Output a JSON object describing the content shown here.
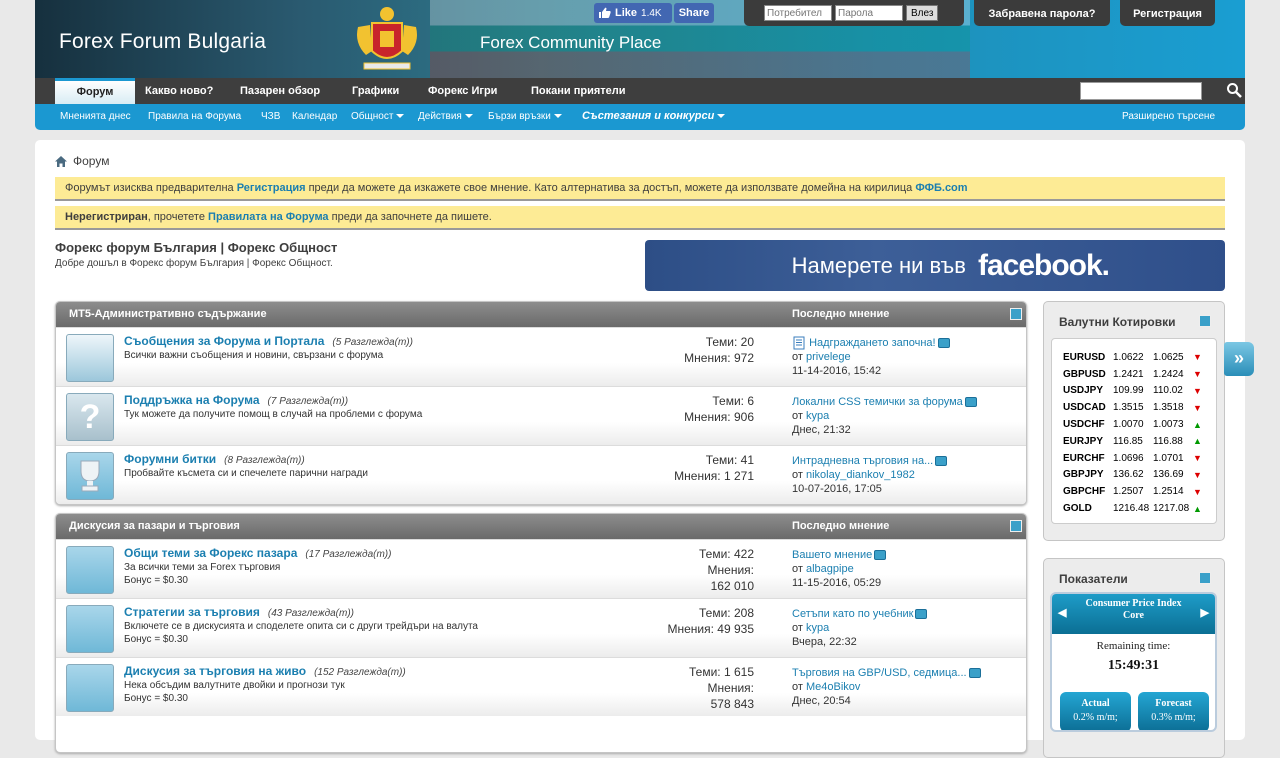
{
  "header": {
    "site_title": "Forex Forum Bulgaria",
    "site_subtitle": "Forex Community Place",
    "fb_like": "Like",
    "fb_like_count": "1.4K",
    "fb_share": "Share",
    "username_placeholder": "Потребител",
    "password_placeholder": "Парола",
    "login_button": "Влез",
    "forgot_password": "Забравена парола?",
    "register": "Регистрация"
  },
  "navbar": {
    "tabs": [
      "Форум",
      "Какво ново?",
      "Пазарен обзор",
      "Графики",
      "Форекс Игри",
      "Покани приятели"
    ]
  },
  "subnav": {
    "items": [
      "Мненията днес",
      "Правила на Форума",
      "ЧЗВ",
      "Календар",
      "Общност",
      "Действия",
      "Бързи връзки",
      "Състезания и конкурси"
    ],
    "advanced_search": "Разширено търсене"
  },
  "breadcrumb": "Форум",
  "notices": {
    "n1_a": "Форумът изисква предварителна ",
    "n1_link": "Регистрация",
    "n1_b": " преди да можете да изкажете свое мнение. Като алтернатива за достъп, можете да използвате домейна на кирилица ",
    "n1_link2": "ФФБ.com",
    "n2_a": "Нерегистриран",
    "n2_b": ", прочетете ",
    "n2_link": "Правилата на Форума",
    "n2_c": " преди да започнете да пишете."
  },
  "forum": {
    "title": "Форекс форум България | Форекс Общност",
    "welcome": "Добре дошъл в Форекс форум България | Форекс Общност.",
    "fb_banner_a": "Намерете ни във",
    "fb_banner_b": "facebook."
  },
  "categories": [
    {
      "name": "MT5-Административно съдържание",
      "last_post_header": "Последно мнение",
      "forums": [
        {
          "title": "Съобщения за Форума и Портала",
          "views": "(5 Разглежда(т))",
          "desc": "Всички важни съобщения и новини, свързани с форума",
          "bonus": "",
          "threads": "Теми: 20",
          "posts": "Мнения: 972",
          "lp_title": "Надграждането започна!",
          "lp_by": "от ",
          "lp_user": "privelege",
          "lp_date": "11-14-2016, 15:42"
        },
        {
          "title": "Поддръжка на Форума",
          "views": "(7 Разглежда(т))",
          "desc": "Тук можете да получите помощ в случай на проблеми с форума",
          "bonus": "",
          "threads": "Теми: 6",
          "posts": "Мнения: 906",
          "lp_title": "Локални CSS темички за форума",
          "lp_by": "от ",
          "lp_user": "kypa",
          "lp_date": "Днес, 21:32"
        },
        {
          "title": "Форумни битки",
          "views": "(8 Разглежда(т))",
          "desc": "Пробвайте късмета си и спечелете парични награди",
          "bonus": "",
          "threads": "Теми: 41",
          "posts": "Мнения: 1 271",
          "lp_title": "Интрадневна търговия на...",
          "lp_by": "от ",
          "lp_user": "nikolay_diankov_1982",
          "lp_date": "10-07-2016, 17:05"
        }
      ]
    },
    {
      "name": "Дискусия за пазари и търговия",
      "last_post_header": "Последно мнение",
      "forums": [
        {
          "title": "Общи теми за Форекс пазара",
          "views": "(17 Разглежда(т))",
          "desc": "За всички теми за Forex търговия",
          "bonus": "Бонус = $0.30",
          "threads": "Теми: 422",
          "posts": "Мнения:",
          "posts2": "162 010",
          "lp_title": "Вашето мнение",
          "lp_by": "от ",
          "lp_user": "albagpipe",
          "lp_date": "11-15-2016, 05:29"
        },
        {
          "title": "Стратегии за търговия",
          "views": "(43 Разглежда(т))",
          "desc": "Включете се в дискусията и споделете опита си с други трейдъри на валута",
          "bonus": "Бонус = $0.30",
          "threads": "Теми: 208",
          "posts": "Мнения: 49 935",
          "lp_title": "Сетъпи като по учебник",
          "lp_by": "от ",
          "lp_user": "kypa",
          "lp_date": "Вчера, 22:32"
        },
        {
          "title": "Дискусия за търговия на живо",
          "views": "(152 Разглежда(т))",
          "desc": "Нека обсъдим валутните двойки и прогнози тук",
          "bonus": "Бонус = $0.30",
          "threads": "Теми: 1 615",
          "posts": "Мнения:",
          "posts2": "578 843",
          "lp_title": "Търговия на GBP/USD, седмица...",
          "lp_by": "от ",
          "lp_user": "Me4oBikov",
          "lp_date": "Днес, 20:54"
        }
      ]
    }
  ],
  "sidebar": {
    "quotes_title": "Валутни Котировки",
    "quotes": [
      {
        "sym": "EURUSD",
        "bid": "1.0622",
        "ask": "1.0625",
        "dir": "down"
      },
      {
        "sym": "GBPUSD",
        "bid": "1.2421",
        "ask": "1.2424",
        "dir": "down"
      },
      {
        "sym": "USDJPY",
        "bid": "109.99",
        "ask": "110.02",
        "dir": "down"
      },
      {
        "sym": "USDCAD",
        "bid": "1.3515",
        "ask": "1.3518",
        "dir": "down"
      },
      {
        "sym": "USDCHF",
        "bid": "1.0070",
        "ask": "1.0073",
        "dir": "up"
      },
      {
        "sym": "EURJPY",
        "bid": "116.85",
        "ask": "116.88",
        "dir": "up"
      },
      {
        "sym": "EURCHF",
        "bid": "1.0696",
        "ask": "1.0701",
        "dir": "down"
      },
      {
        "sym": "GBPJPY",
        "bid": "136.62",
        "ask": "136.69",
        "dir": "down"
      },
      {
        "sym": "GBPCHF",
        "bid": "1.2507",
        "ask": "1.2514",
        "dir": "down"
      },
      {
        "sym": "GOLD",
        "bid": "1216.48",
        "ask": "1217.08",
        "dir": "up"
      }
    ],
    "indicators_title": "Показатели",
    "indicator_name": "Consumer Price Index Core",
    "remaining_label": "Remaining time:",
    "remaining_time": "15:49:31",
    "actual_label": "Actual",
    "actual_value": "0.2% m/m;",
    "forecast_label": "Forecast",
    "forecast_value": "0.3% m/m;"
  },
  "colors": {
    "accent": "#1b98d1",
    "link": "#1b7fb0",
    "notice": "#fdeb95"
  }
}
